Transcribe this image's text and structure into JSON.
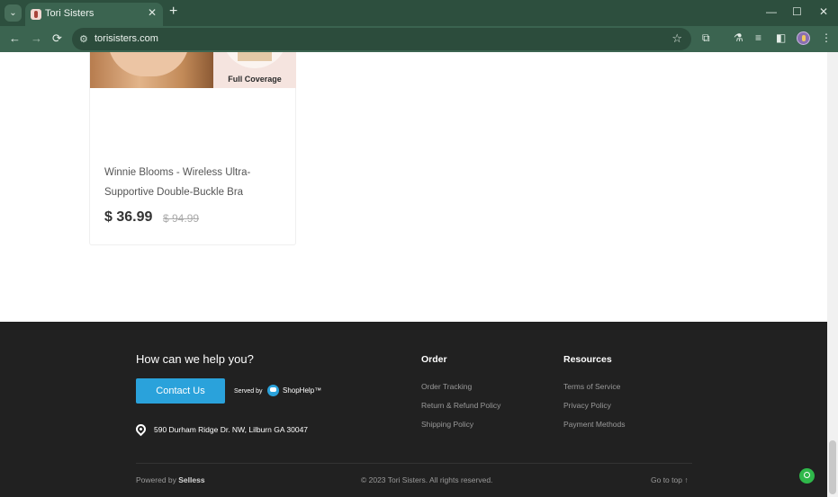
{
  "browser": {
    "tab_title": "Tori Sisters",
    "tab_close": "✕",
    "new_tab": "+",
    "tab_search_icon": "⌄",
    "window_controls": {
      "minimize": "—",
      "maximize": "☐",
      "close": "✕"
    },
    "nav": {
      "back": "←",
      "forward": "→",
      "reload": "⟳"
    },
    "url": "torisisters.com",
    "site_icon": "⚙",
    "bookmark_star": "☆",
    "toolbar_icons": {
      "extensions": "⧉",
      "labs": "⚗",
      "reading_list": "≡",
      "side_panel": "◧",
      "menu": "⋮"
    }
  },
  "product": {
    "image_caption": "Full Coverage",
    "title": "Winnie Blooms - Wireless Ultra-Supportive Double-Buckle Bra",
    "price": "$ 36.99",
    "old_price": "$ 94.99"
  },
  "footer": {
    "help_heading": "How can we help you?",
    "contact_button": "Contact Us",
    "served_by": "Served by",
    "shophelp": "ShopHelp™",
    "address": "590 Durham Ridge Dr. NW, Lilburn GA 30047",
    "order": {
      "heading": "Order",
      "links": [
        "Order Tracking",
        "Return & Refund Policy",
        "Shipping Policy"
      ]
    },
    "resources": {
      "heading": "Resources",
      "links": [
        "Terms of Service",
        "Privacy Policy",
        "Payment Methods"
      ]
    },
    "powered_by": "Powered by",
    "powered_brand": "Selless",
    "copyright": "© 2023 Tori Sisters. All rights reserved.",
    "go_to_top": "Go to top ↑"
  },
  "colors": {
    "chrome": "#3b6450",
    "footer_bg": "#212121",
    "accent": "#2aa2db",
    "chat": "#2fb84a"
  }
}
